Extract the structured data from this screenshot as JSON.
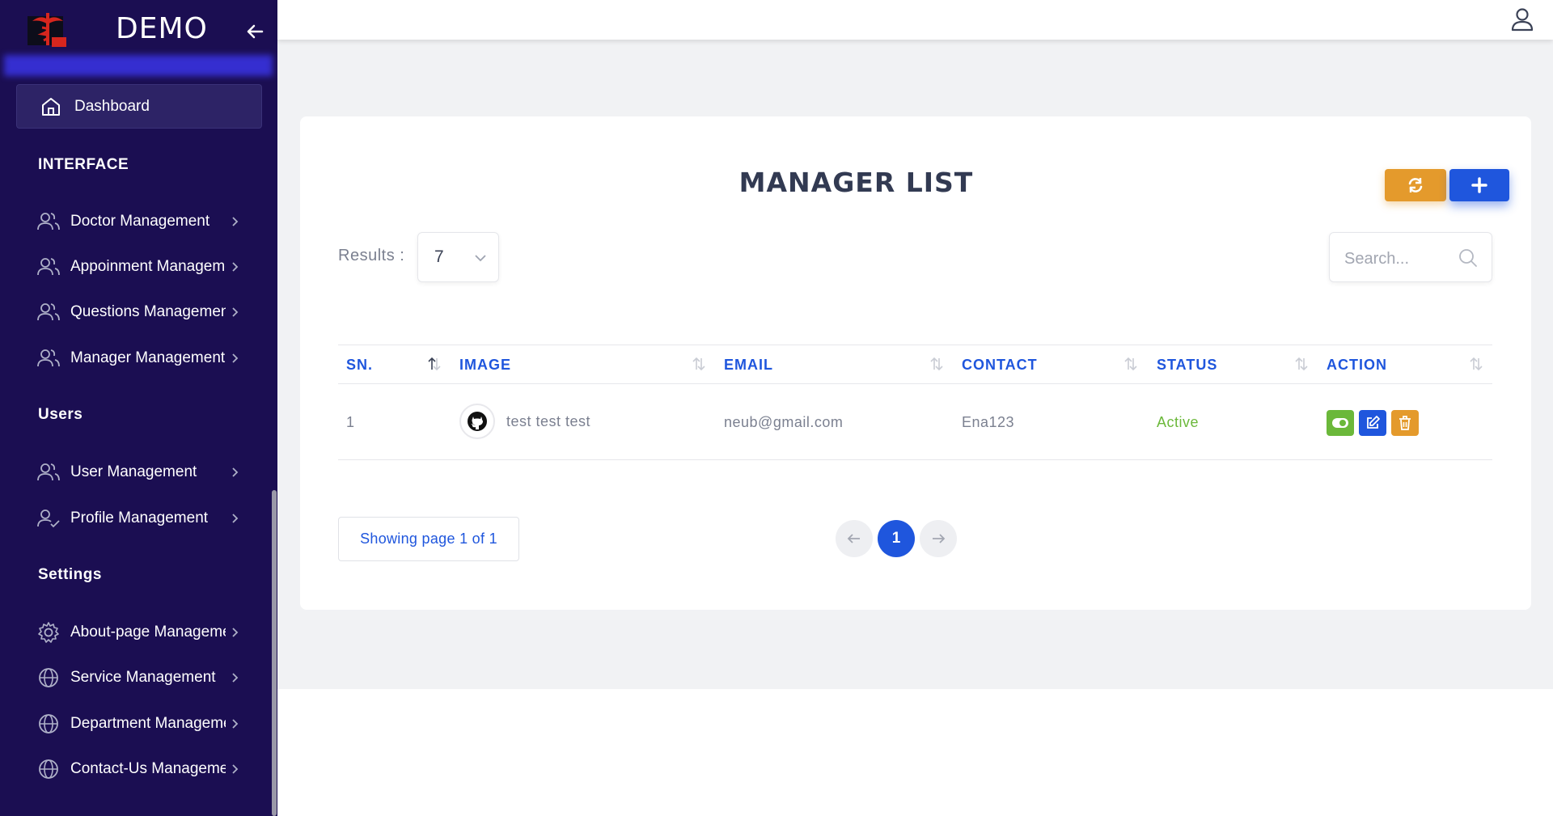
{
  "brand": {
    "name": "DEMO"
  },
  "sidebar": {
    "dashboard_label": "Dashboard",
    "sections": {
      "interface": "INTERFACE",
      "users": "Users",
      "settings": "Settings"
    },
    "items": [
      {
        "label": "Doctor Management",
        "icon": "users-icon"
      },
      {
        "label": "Appoinment Management",
        "icon": "users-icon"
      },
      {
        "label": "Questions Management",
        "icon": "users-icon"
      },
      {
        "label": "Manager Management",
        "icon": "users-icon"
      },
      {
        "label": "User Management",
        "icon": "users-icon"
      },
      {
        "label": "Profile Management",
        "icon": "user-check-icon"
      },
      {
        "label": "About-page Management",
        "icon": "gear-icon"
      },
      {
        "label": "Service Management",
        "icon": "globe-icon"
      },
      {
        "label": "Department Management",
        "icon": "globe-icon"
      },
      {
        "label": "Contact-Us Management",
        "icon": "globe-icon"
      }
    ]
  },
  "page": {
    "title": "MANAGER LIST",
    "results_label": "Results :",
    "results_value": "7",
    "search_placeholder": "Search..."
  },
  "table": {
    "columns": [
      "SN.",
      "IMAGE",
      "EMAIL",
      "CONTACT",
      "STATUS",
      "ACTION"
    ],
    "rows": [
      {
        "sn": "1",
        "name": "test test test",
        "email": "neub@gmail.com",
        "contact": "Ena123",
        "status": "Active"
      }
    ]
  },
  "pagination": {
    "info": "Showing page 1 of 1",
    "current": "1"
  },
  "colors": {
    "sidebar_bg": "#1b0e52",
    "accent_blue": "#1f56dd",
    "accent_orange": "#e49a2c",
    "status_green": "#6bb83a"
  }
}
